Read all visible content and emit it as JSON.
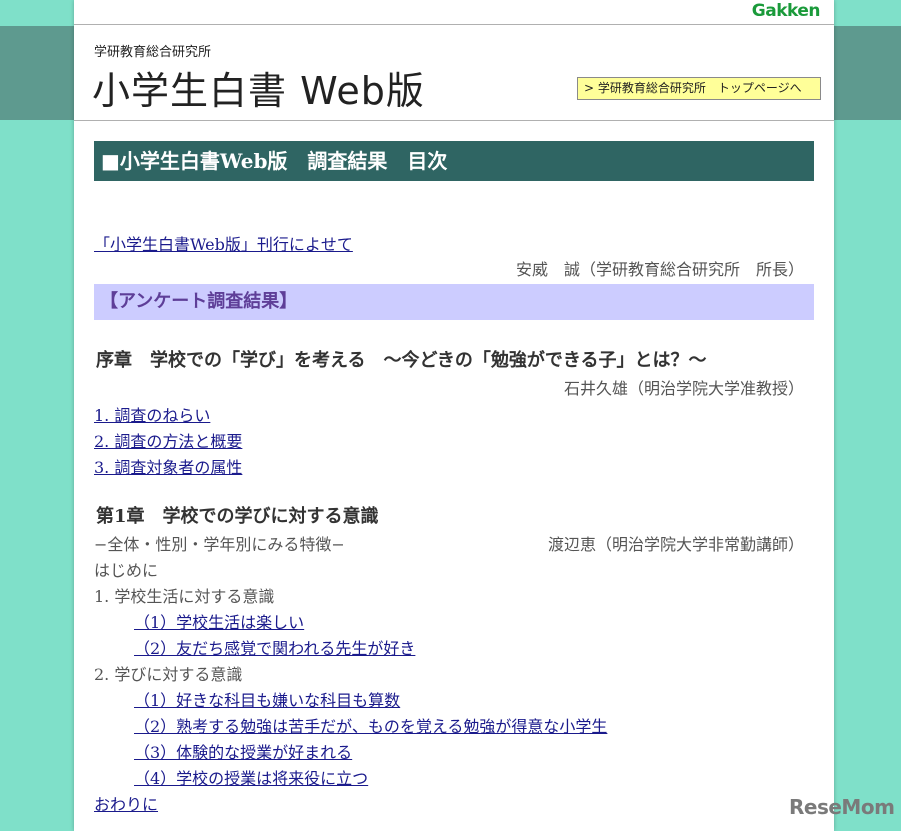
{
  "header": {
    "brand": "Gakken",
    "subtitle": "学研教育総合研究所",
    "title": "小学生白書 Web版",
    "top_link": "> 学研教育総合研究所　トップページへ"
  },
  "main": {
    "section_title": "■小学生白書Web版　調査結果　目次",
    "intro_link": "「小学生白書Web版」刊行によせて",
    "intro_author": "安威　誠（学研教育総合研究所　所長）",
    "survey_heading": "【アンケート調査結果】",
    "prologue": {
      "title": "序章　学校での「学び」を考える　〜今どきの「勉強ができる子」とは？〜",
      "author": "石井久雄（明治学院大学准教授）",
      "links": [
        "1. 調査のねらい",
        "2. 調査の方法と概要",
        "3. 調査対象者の属性"
      ]
    },
    "chapter1": {
      "title": "第1章　学校での学びに対する意識",
      "subtitle": "−全体・性別・学年別にみる特徴−",
      "author": "渡辺恵（明治学院大学非常勤講師）",
      "intro": "はじめに",
      "section1": {
        "label": "1.  学校生活に対する意識",
        "links": [
          "（1）学校生活は楽しい",
          "（2）友だち感覚で関われる先生が好き"
        ]
      },
      "section2": {
        "label": "2.  学びに対する意識",
        "links": [
          "（1）好きな科目も嫌いな科目も算数",
          "（2）熟考する勉強は苦手だが、ものを覚える勉強が得意な小学生",
          "（3）体験的な授業が好まれる",
          "（4）学校の授業は将来役に立つ"
        ]
      },
      "outro_link": "おわりに"
    }
  },
  "watermark": "ReseMom"
}
